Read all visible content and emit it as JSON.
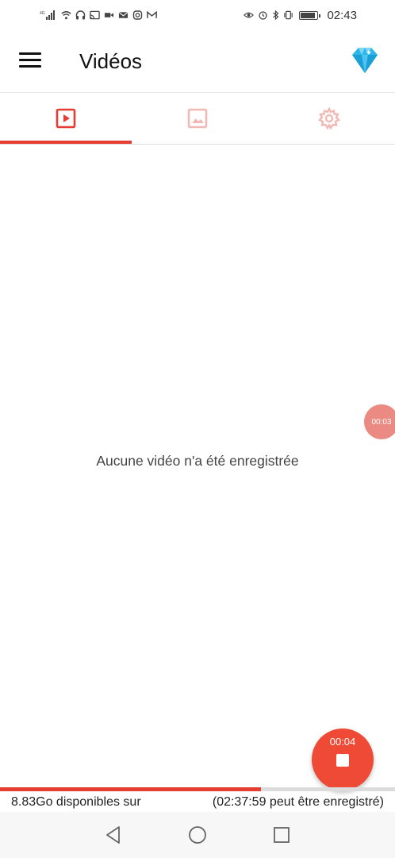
{
  "status_bar": {
    "time": "02:43",
    "battery_level": 0.9,
    "left_icons": [
      "network-type-icon",
      "signal-icon",
      "wifi-icon",
      "headset-icon",
      "cast-icon",
      "video-camera-icon",
      "mail-icon",
      "instagram-icon",
      "gmail-icon"
    ],
    "right_icons": [
      "eye-icon",
      "alarm-icon",
      "bluetooth-icon",
      "vibrate-icon",
      "battery-icon"
    ]
  },
  "app_bar": {
    "title": "Vidéos",
    "menu_icon": "hamburger-menu-icon",
    "premium_icon": "diamond-icon"
  },
  "tabs": [
    {
      "name": "videos",
      "icon": "play-video-icon",
      "active": true
    },
    {
      "name": "images",
      "icon": "image-icon",
      "active": false
    },
    {
      "name": "settings",
      "icon": "gear-icon",
      "active": false
    }
  ],
  "empty_message": "Aucune vidéo n'a été enregistrée",
  "floating_timer": "00:03",
  "stop_fab": {
    "time": "00:04",
    "icon": "stop-icon"
  },
  "storage": {
    "available_text": "8.83Go disponibles sur",
    "remaining_text": "(02:37:59 peut être enregistré)",
    "used_fraction": 0.66
  },
  "nav_bar": {
    "buttons": [
      "back-icon",
      "home-icon",
      "recents-icon"
    ]
  },
  "colors": {
    "accent": "#e63d32",
    "fab": "#ee4a36",
    "float_timer": "#ea8a82",
    "tab_inactive": "#f2b8b3"
  }
}
